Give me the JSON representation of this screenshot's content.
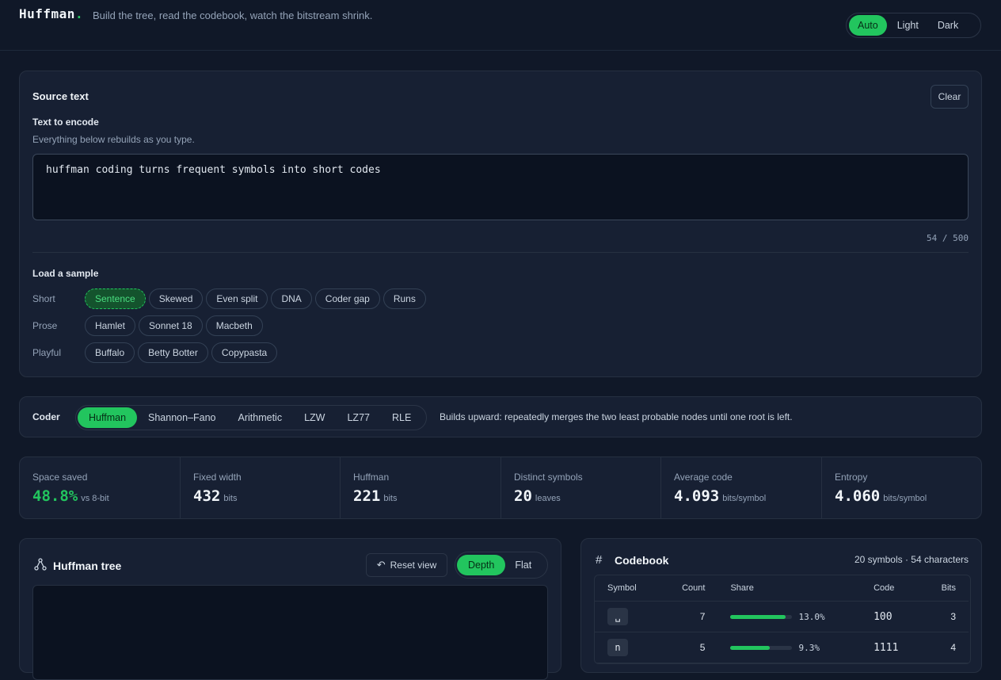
{
  "header": {
    "logo": "Huffman",
    "logo_dot": ".",
    "tagline": "Build the tree, read the codebook, watch the bitstream shrink.",
    "theme_options": [
      "Auto",
      "Light",
      "Dark"
    ],
    "theme_selected": "Auto"
  },
  "source": {
    "title": "Source text",
    "clear_label": "Clear",
    "field_label": "Text to encode",
    "field_hint": "Everything below rebuilds as you type.",
    "text_value": "huffman coding turns frequent symbols into short codes",
    "counter": "54 / 500",
    "samples_title": "Load a sample",
    "sample_groups": [
      {
        "label": "Short",
        "items": [
          "Sentence",
          "Skewed",
          "Even split",
          "DNA",
          "Coder gap",
          "Runs"
        ]
      },
      {
        "label": "Prose",
        "items": [
          "Hamlet",
          "Sonnet 18",
          "Macbeth"
        ]
      },
      {
        "label": "Playful",
        "items": [
          "Buffalo",
          "Betty Botter",
          "Copypasta"
        ]
      }
    ],
    "selected_sample": "Sentence"
  },
  "coder": {
    "label": "Coder",
    "options": [
      "Huffman",
      "Shannon–Fano",
      "Arithmetic",
      "LZW",
      "LZ77",
      "RLE"
    ],
    "selected": "Huffman",
    "description": "Builds upward: repeatedly merges the two least probable nodes until one root is left."
  },
  "stats": [
    {
      "label": "Space saved",
      "value": "48.8%",
      "unit": "vs 8-bit",
      "accent": true
    },
    {
      "label": "Fixed width",
      "value": "432",
      "unit": "bits"
    },
    {
      "label": "Huffman",
      "value": "221",
      "unit": "bits"
    },
    {
      "label": "Distinct symbols",
      "value": "20",
      "unit": "leaves"
    },
    {
      "label": "Average code",
      "value": "4.093",
      "unit": "bits/symbol"
    },
    {
      "label": "Entropy",
      "value": "4.060",
      "unit": "bits/symbol"
    }
  ],
  "tree": {
    "title": "Huffman tree",
    "reset_label": "Reset view",
    "view_options": [
      "Depth",
      "Flat"
    ],
    "view_selected": "Depth"
  },
  "codebook": {
    "title": "Codebook",
    "summary": "20 symbols · 54 characters",
    "columns": [
      "Symbol",
      "Count",
      "Share",
      "Code",
      "Bits"
    ],
    "rows": [
      {
        "symbol": "␣",
        "count": "7",
        "share": 0.13,
        "share_label": "13.0%",
        "code": "100",
        "bits": "3"
      },
      {
        "symbol": "n",
        "count": "5",
        "share": 0.093,
        "share_label": "9.3%",
        "code": "1111",
        "bits": "4"
      }
    ]
  },
  "colors": {
    "accent": "#22c55e",
    "background": "#101828",
    "card": "#172033"
  }
}
